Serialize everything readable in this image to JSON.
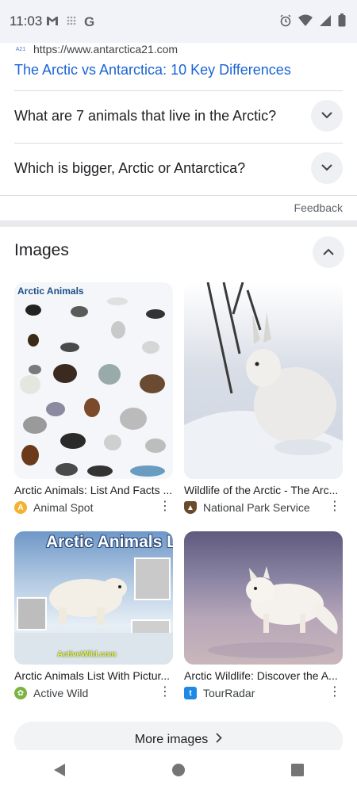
{
  "status": {
    "time": "11:03",
    "left_icons": [
      "gmail-icon",
      "grid-dots-icon",
      "google-g-icon"
    ],
    "right_icons": [
      "alarm-icon",
      "wifi-icon",
      "signal-icon",
      "battery-icon"
    ]
  },
  "result": {
    "favicon_text": "A21",
    "url": "https://www.antarctica21.com",
    "title": "The Arctic vs Antarctica: 10 Key Differences"
  },
  "faqs": [
    {
      "question": "What are 7 animals that live in the Arctic?"
    },
    {
      "question": "Which is bigger, Arctic or Antarctica?"
    }
  ],
  "feedback_label": "Feedback",
  "images": {
    "title": "Images",
    "items": [
      {
        "caption": "Arctic Animals: List And Facts ...",
        "source": "Animal Spot",
        "thumb_text": "Arctic Animals"
      },
      {
        "caption": "Wildlife of the Arctic - The Arc...",
        "source": "National Park Service",
        "thumb_text": ""
      },
      {
        "caption": "Arctic Animals List With Pictur...",
        "source": "Active Wild",
        "thumb_text": "Arctic Animals L",
        "thumb_sub": "ActiveWild.com"
      },
      {
        "caption": "Arctic Wildlife: Discover the A...",
        "source": "TourRadar",
        "thumb_text": ""
      }
    ],
    "more_label": "More images"
  },
  "colors": {
    "link_blue": "#1a64d6",
    "status_bg": "#f1f3f8",
    "chip_bg": "#eef0f3"
  }
}
